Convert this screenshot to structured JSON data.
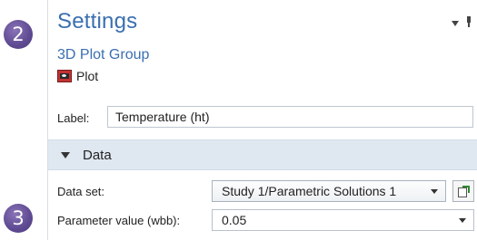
{
  "badges": {
    "top": "2",
    "bottom": "3"
  },
  "settings": {
    "title": "Settings",
    "subtitle": "3D Plot Group",
    "node_label": "Plot"
  },
  "label_field": {
    "label": "Label:",
    "value": "Temperature (ht)"
  },
  "data_section": {
    "title": "Data",
    "dataset_label": "Data set:",
    "dataset_value": "Study 1/Parametric Solutions 1",
    "parameter_label": "Parameter value (wbb):",
    "parameter_value": "0.05"
  },
  "colors": {
    "accent": "#3a6fb0",
    "section_header_bg": "#dfe8f1",
    "badge": "#5e4a91"
  },
  "icons": [
    "menu-chevron-icon",
    "pin-icon",
    "plot-icon",
    "collapse-triangle-icon",
    "dropdown-arrow-icon",
    "go-to-source-icon"
  ]
}
